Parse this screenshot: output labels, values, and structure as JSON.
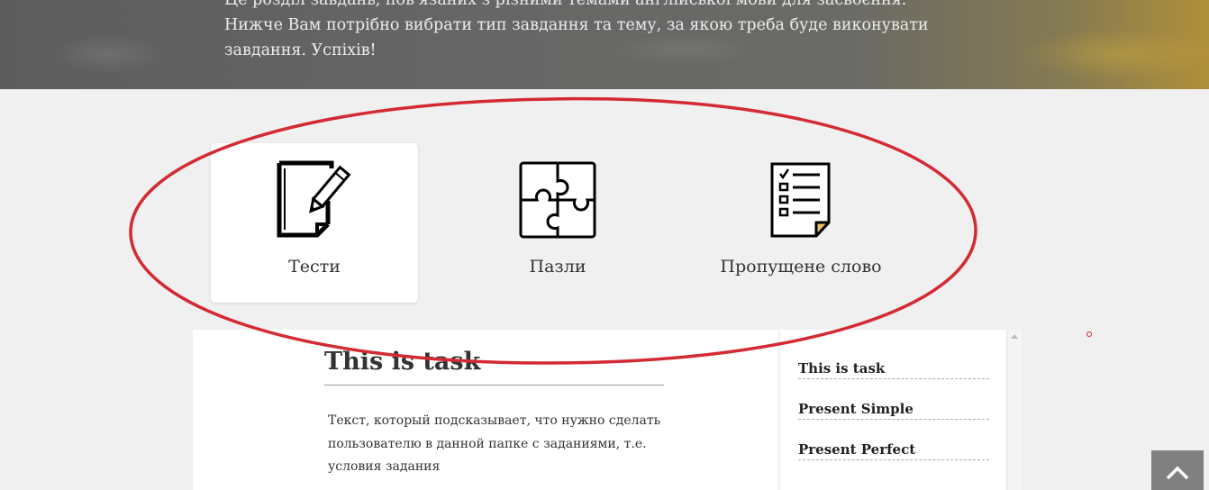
{
  "hero": {
    "lines": [
      "Це розділ завдань, пов'язаних з різними темами англійської мови для засвоєння.",
      "Нижче Вам потрібно вибрати тип завдання та тему, за якою треба буде виконувати",
      "завдання. Успіхів!"
    ]
  },
  "task_types": [
    {
      "label": "Тести",
      "icon": "notepad-pencil-icon",
      "active": true
    },
    {
      "label": "Пазли",
      "icon": "puzzle-icon",
      "active": false
    },
    {
      "label": "Пропущене слово",
      "icon": "checklist-icon",
      "active": false
    }
  ],
  "task": {
    "title": "This is task",
    "description": "Текст, который подсказывает, что нужно сделать пользователю в данной папке с заданиями, т.е. условия задания"
  },
  "sidebar": {
    "items": [
      {
        "label": "This is task"
      },
      {
        "label": "Present Simple"
      },
      {
        "label": "Present Perfect"
      }
    ]
  },
  "colors": {
    "annotation": "#d42a33",
    "scroll_top_bg": "#808080",
    "icon_accent": "#f2c46a"
  },
  "icons": {
    "scroll_top": "chevron-up-icon",
    "scrollbar_up": "scroll-up-arrow-icon"
  }
}
